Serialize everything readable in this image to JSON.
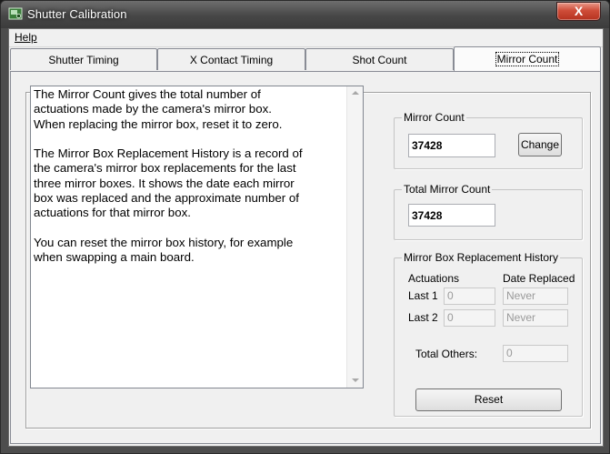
{
  "window": {
    "title": "Shutter Calibration",
    "close_glyph": "X"
  },
  "menu": {
    "help_label": "Help"
  },
  "tabs": [
    {
      "label": "Shutter Timing"
    },
    {
      "label": "X Contact Timing"
    },
    {
      "label": "Shot Count"
    },
    {
      "label": "Mirror Count"
    }
  ],
  "active_tab": "Mirror Count",
  "description": "The Mirror Count gives the total number of\nactuations made by the camera's mirror box.\nWhen replacing the mirror box, reset it to zero.\n\nThe Mirror Box Replacement History is a record of\nthe camera's mirror box replacements for the last\nthree mirror boxes. It shows the date each mirror\nbox was replaced and the approximate number of\nactuations for that mirror box.\n\nYou can reset the mirror box history, for example\nwhen swapping a main board.",
  "mirror_count": {
    "legend": "Mirror Count",
    "value": "37428",
    "change_label": "Change"
  },
  "total_mirror_count": {
    "legend": "Total Mirror Count",
    "value": "37428"
  },
  "history": {
    "legend": "Mirror Box Replacement History",
    "col_actuations": "Actuations",
    "col_date": "Date Replaced",
    "rows": [
      {
        "label": "Last 1",
        "actuations": "0",
        "date": "Never"
      },
      {
        "label": "Last 2",
        "actuations": "0",
        "date": "Never"
      }
    ],
    "total_others_label": "Total Others:",
    "total_others_value": "0",
    "reset_label": "Reset"
  }
}
